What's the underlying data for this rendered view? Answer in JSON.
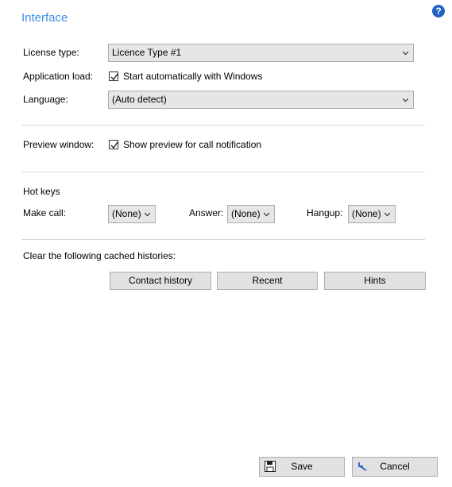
{
  "page": {
    "title": "Interface",
    "help_glyph": "?"
  },
  "license": {
    "label": "License type:",
    "value": "Licence Type #1"
  },
  "app_load": {
    "label": "Application load:",
    "checkbox_label": "Start automatically with Windows",
    "checked": true
  },
  "language": {
    "label": "Language:",
    "value": "(Auto detect)"
  },
  "preview": {
    "label": "Preview window:",
    "checkbox_label": "Show preview for call notification",
    "checked": true
  },
  "hotkeys": {
    "heading": "Hot keys",
    "make_call": {
      "label": "Make call:",
      "value": "(None)"
    },
    "answer": {
      "label": "Answer:",
      "value": "(None)"
    },
    "hangup": {
      "label": "Hangup:",
      "value": "(None)"
    }
  },
  "cache": {
    "heading": "Clear the following cached histories:",
    "buttons": [
      "Contact history",
      "Recent",
      "Hints"
    ]
  },
  "footer": {
    "save_label": "Save",
    "cancel_label": "Cancel"
  },
  "icons": {
    "help": "help-icon",
    "save": "floppy-disk-icon",
    "cancel": "undo-arrow-icon",
    "dropdown": "chevron-down-icon",
    "check": "checkmark-icon"
  },
  "colors": {
    "title": "#3a8ee6",
    "help_badge": "#1f63c6",
    "cancel_arrow": "#1f63c6"
  }
}
